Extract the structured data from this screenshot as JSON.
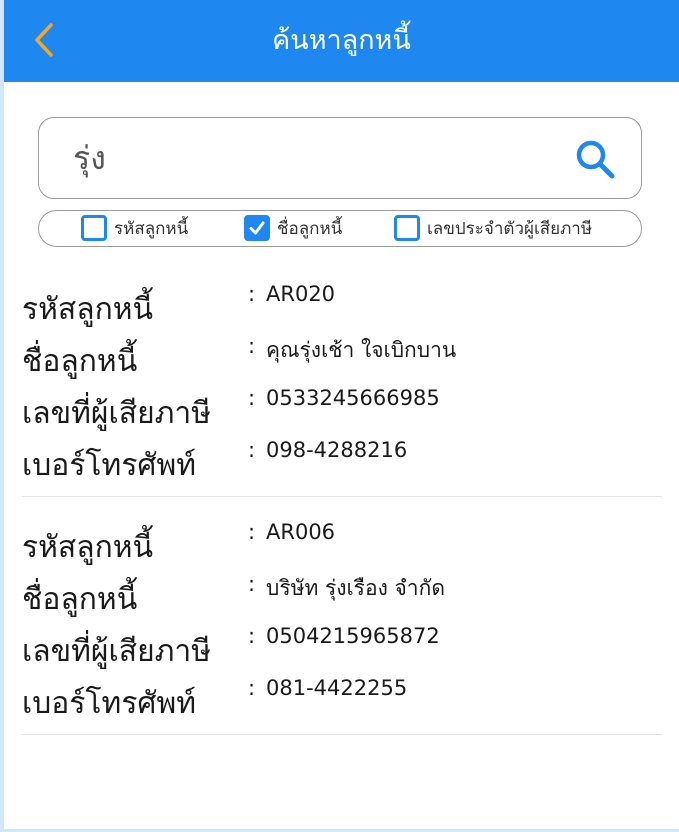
{
  "header": {
    "title": "ค้นหาลูกหนี้"
  },
  "search": {
    "value": "รุ่ง",
    "placeholder": ""
  },
  "filters": [
    {
      "label": "รหัสลูกหนี้",
      "checked": false
    },
    {
      "label": "ชื่อลูกหนี้",
      "checked": true
    },
    {
      "label": "เลขประจำตัวผู้เสียภาษี",
      "checked": false
    }
  ],
  "field_labels": {
    "code": "รหัสลูกหนี้",
    "name": "ชื่อลูกหนี้",
    "tax_id": "เลขที่ผู้เสียภาษี",
    "phone": "เบอร์โทรศัพท์"
  },
  "separator": ":",
  "results": [
    {
      "code": "AR020",
      "name": "คุณรุ่งเช้า ใจเบิกบาน",
      "tax_id": "0533245666985",
      "phone": "098-4288216"
    },
    {
      "code": "AR006",
      "name": "บริษัท รุ่งเรือง จำกัด",
      "tax_id": "0504215965872",
      "phone": "081-4422255"
    }
  ],
  "colors": {
    "primary": "#1e88f0",
    "header_text": "#ffffff",
    "back_icon": "#f5a623",
    "caret": "#1a8a6e"
  },
  "icons": {
    "back": "chevron-left-icon",
    "search": "magnifier-icon",
    "check": "check-icon"
  }
}
